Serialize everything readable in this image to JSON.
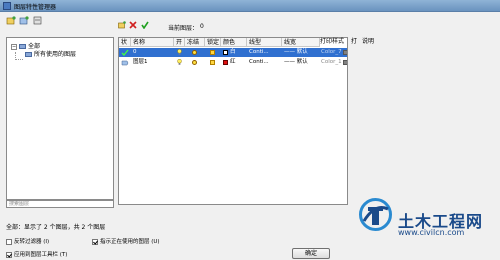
{
  "window": {
    "title": "图层特性管理器"
  },
  "tree": {
    "items": [
      {
        "label": "全部",
        "toggle": "−"
      },
      {
        "label": "所有使用的图层"
      }
    ]
  },
  "search": {
    "placeholder": "搜索图层"
  },
  "current_layer": {
    "label": "当前图层：",
    "value": "0"
  },
  "table": {
    "columns": [
      "状",
      "名称",
      "开",
      "冻结",
      "锁定",
      "颜色",
      "线型",
      "线宽",
      "打印样式",
      "打",
      "说明"
    ],
    "rows": [
      {
        "name": "0",
        "color_name": "白",
        "color": "#ffffff",
        "linetype": "Conti...",
        "lineweight": "—— 默认",
        "plot_style": "Color_7",
        "selected": true
      },
      {
        "name": "图层1",
        "color_name": "红",
        "color": "#e01010",
        "linetype": "Conti...",
        "lineweight": "—— 默认",
        "plot_style": "Color_1",
        "selected": false
      }
    ]
  },
  "status": {
    "text": "全部：显示了 2 个图层，共 2 个图层"
  },
  "options": {
    "invert_filter": {
      "label": "反转过滤器 (I)",
      "checked": false
    },
    "apply_toolbar": {
      "label": "应用到图层工具栏 (T)",
      "checked": true
    },
    "show_in_use": {
      "label": "指示正在使用的图层 (U)",
      "checked": true
    }
  },
  "buttons": {
    "ok": "确定"
  },
  "watermark": {
    "title": "土木工程网",
    "url": "www.civilcn.com"
  },
  "colors": {
    "selection": "#3070d0",
    "titlebar": "#7aa0c8",
    "watermark": "#1a4a8a"
  }
}
